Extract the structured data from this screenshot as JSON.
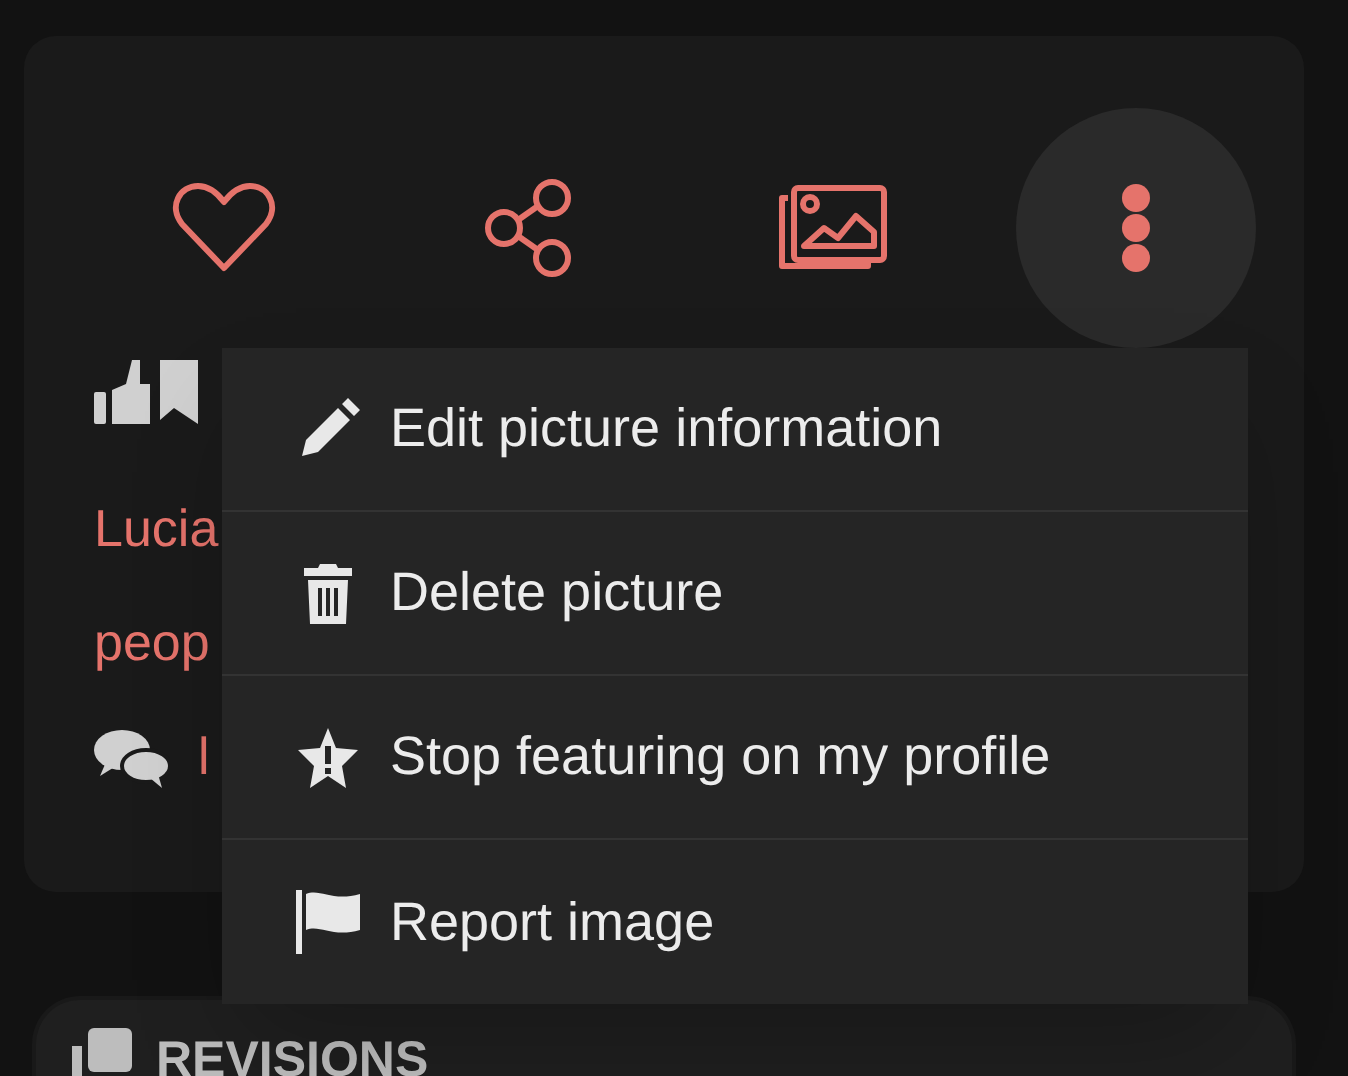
{
  "actions": [
    {
      "kind": "like",
      "expanded": false
    },
    {
      "kind": "share",
      "expanded": false
    },
    {
      "kind": "gallery",
      "expanded": false
    },
    {
      "kind": "more",
      "expanded": true
    }
  ],
  "details": [
    {
      "kind": "reactions"
    },
    {
      "kind": "text",
      "text": "Lucia"
    },
    {
      "kind": "text",
      "text": "peop"
    },
    {
      "kind": "comments",
      "text": "l"
    }
  ],
  "menu": [
    {
      "kind": "edit",
      "label": "Edit picture information"
    },
    {
      "kind": "delete",
      "label": "Delete picture"
    },
    {
      "kind": "feature",
      "label": "Stop featuring on my profile"
    },
    {
      "kind": "report",
      "label": "Report image"
    }
  ],
  "revisions": {
    "title": "REVISIONS"
  }
}
